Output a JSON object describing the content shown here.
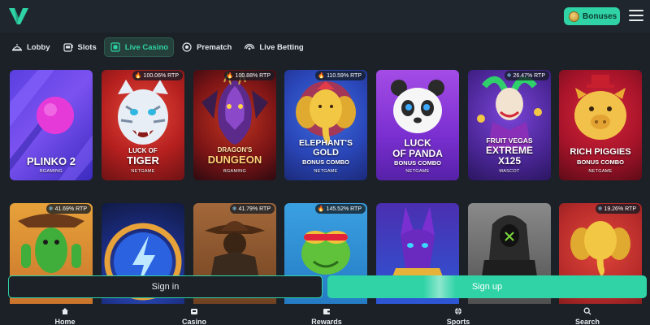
{
  "header": {
    "bonuses_label": "Bonuses",
    "accent_color": "#2fd3a6"
  },
  "nav": {
    "tabs": [
      {
        "label": "Lobby",
        "icon": "lobby-icon",
        "active": false
      },
      {
        "label": "Slots",
        "icon": "slot-machine-icon",
        "active": false
      },
      {
        "label": "Live Casino",
        "icon": "live-casino-icon",
        "active": true
      },
      {
        "label": "Prematch",
        "icon": "ball-icon",
        "active": false
      },
      {
        "label": "Live Betting",
        "icon": "live-signal-icon",
        "active": false
      }
    ]
  },
  "games": {
    "row1": [
      {
        "title": "PLINKO 2",
        "provider": "BGAMING",
        "rtp": ""
      },
      {
        "title_top": "LUCK OF",
        "title": "TIGER",
        "provider": "NETGAME",
        "rtp": "100.06% RTP",
        "rtp_icon": "fire-icon"
      },
      {
        "title_top": "DRAGON'S",
        "title": "DUNGEON",
        "provider": "BGAMING",
        "rtp": "100.88% RTP",
        "rtp_icon": "fire-icon"
      },
      {
        "title_top": "ELEPHANT'S",
        "title": "GOLD",
        "subtitle": "BONUS COMBO",
        "provider": "NETGAME",
        "rtp": "110.59% RTP",
        "rtp_icon": "fire-icon"
      },
      {
        "title_top": "LUCK",
        "title": "OF PANDA",
        "subtitle": "BONUS COMBO",
        "provider": "NETGAME",
        "rtp": ""
      },
      {
        "title_top": "FRUIT VEGAS",
        "title": "EXTREME",
        "title_bottom": "X125",
        "provider": "MASCOT",
        "rtp": "26.47% RTP",
        "rtp_icon": "snowflake-icon"
      },
      {
        "title": "RICH PIGGIES",
        "subtitle": "BONUS COMBO",
        "provider": "NETGAME",
        "rtp": ""
      }
    ],
    "row2": [
      {
        "rtp": "41.69% RTP",
        "rtp_icon": "snowflake-icon"
      },
      {
        "rtp": ""
      },
      {
        "rtp": "41.79% RTP",
        "rtp_icon": "snowflake-icon"
      },
      {
        "rtp": "145.52% RTP",
        "rtp_icon": "fire-icon"
      },
      {
        "rtp": ""
      },
      {
        "rtp": ""
      },
      {
        "rtp": "19.26% RTP",
        "rtp_icon": "snowflake-icon"
      }
    ]
  },
  "auth": {
    "signin_label": "Sign in",
    "signup_label": "Sign up"
  },
  "bottom_nav": [
    {
      "label": "Home",
      "icon": "home-icon"
    },
    {
      "label": "Casino",
      "icon": "casino-icon"
    },
    {
      "label": "Rewards",
      "icon": "wallet-icon"
    },
    {
      "label": "Sports",
      "icon": "ball-icon"
    },
    {
      "label": "Search",
      "icon": "search-icon"
    }
  ]
}
